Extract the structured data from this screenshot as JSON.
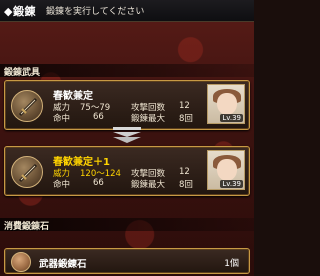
{
  "header": {
    "title": "◆鍛錬",
    "subtitle": "鍛錬を実行してください"
  },
  "sections": {
    "weapon": "鍛錬武具",
    "material": "消費鍛錬石"
  },
  "before": {
    "name": "春歓兼定",
    "power_label": "威力",
    "power_value": "75～79",
    "accuracy_label": "命中",
    "accuracy_value": "66",
    "attacks_label": "攻撃回数",
    "attacks_value": "12",
    "max_label": "鍛錬最大",
    "max_value": "8回",
    "avatar_level": "Lv.39"
  },
  "after": {
    "name": "春歓兼定＋1",
    "power_label": "威力",
    "power_value": "120～124",
    "accuracy_label": "命中",
    "accuracy_value": "66",
    "attacks_label": "攻撃回数",
    "attacks_value": "12",
    "max_label": "鍛錬最大",
    "max_value": "8回",
    "avatar_level": "Lv.39"
  },
  "material": {
    "name": "武器鍛錬石",
    "count": "1個"
  },
  "icons": {
    "weapon": "sword-icon",
    "arrow": "down-arrows-icon",
    "stone": "forging-stone-icon"
  },
  "colors": {
    "highlight": "#ffd400",
    "frame": "#c79a45"
  }
}
